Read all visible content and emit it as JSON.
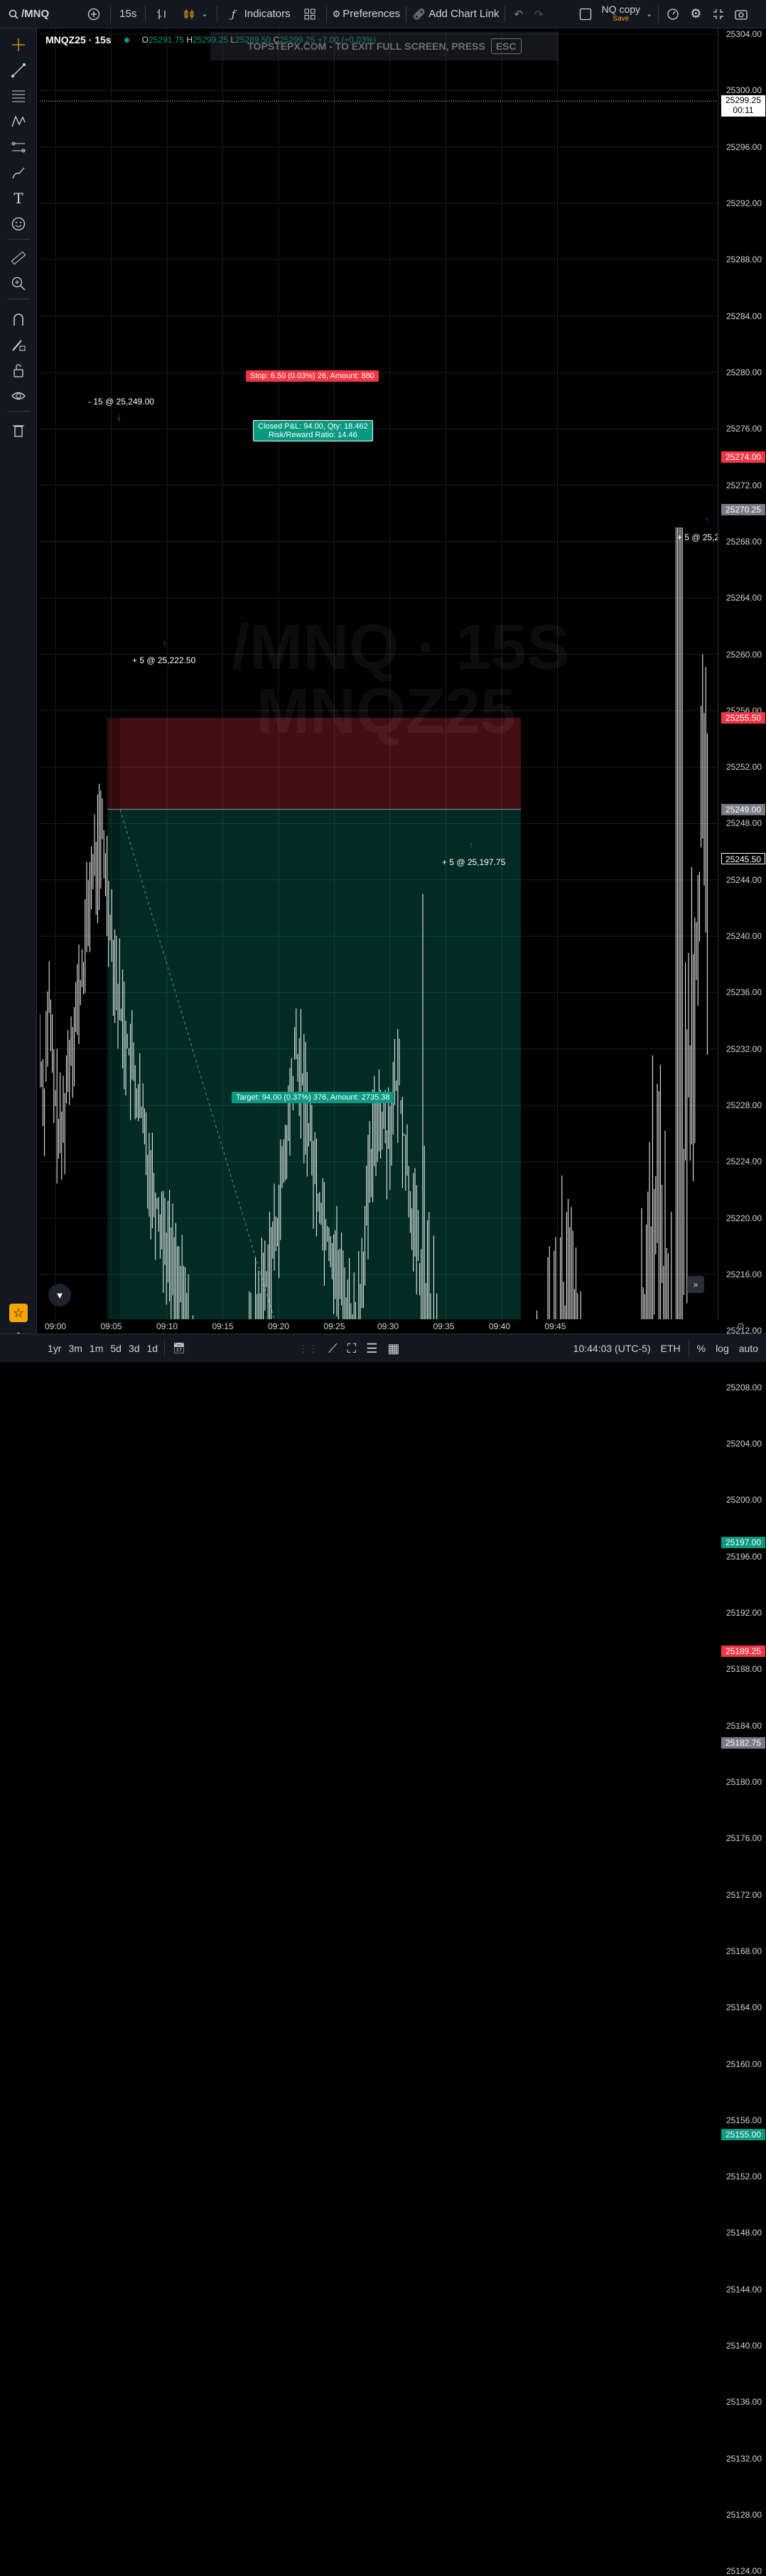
{
  "topbar": {
    "symbol": "/MNQ",
    "interval": "15s",
    "indicators": "Indicators",
    "preferences": "Preferences",
    "add_chart_link": "Add Chart Link",
    "layout_name": "NQ copy",
    "layout_save": "Save"
  },
  "legend": {
    "title": "MNQZ25 · 15s",
    "o_label": "O",
    "o": "25291.75",
    "h_label": "H",
    "h": "25299.25",
    "l_label": "L",
    "l": "25289.50",
    "c_label": "C",
    "c": "25299.25 +7.00 (+0.03%)"
  },
  "banner": {
    "text": "TOPSTEPX.COM - TO EXIT FULL SCREEN, PRESS",
    "key": "ESC"
  },
  "watermark": {
    "line1": "/MNQ · 15S",
    "line2": "MNQZ25"
  },
  "position_tool": {
    "stop_label": "Stop: 6.50 (0.03%) 26, Amount: 880",
    "pnl_line1": "Closed P&L: 94.00, Qty: 18.462",
    "pnl_line2": "Risk/Reward Ratio: 14.46",
    "target_label": "Target: 94.00 (0.37%) 376, Amount: 2735.38"
  },
  "trades": [
    {
      "label": "- 15 @ 25,249.00"
    },
    {
      "label": "+ 5 @ 25,222.50"
    },
    {
      "label": "+ 5 @ 25,197.75"
    },
    {
      "label": "+ 5 @ 25,2"
    }
  ],
  "price_axis": {
    "ticks": [
      "25304.00",
      "25300.00",
      "25296.00",
      "25292.00",
      "25288.00",
      "25284.00",
      "25280.00",
      "25276.00",
      "25272.00",
      "25268.00",
      "25264.00",
      "25260.00",
      "25256.00",
      "25252.00",
      "25248.00",
      "25244.00",
      "25240.00",
      "25236.00",
      "25232.00",
      "25228.00",
      "25224.00",
      "25220.00",
      "25216.00",
      "25212.00",
      "25208.00",
      "25204.00",
      "25200.00",
      "25196.00",
      "25192.00",
      "25188.00",
      "25184.00",
      "25180.00",
      "25176.00",
      "25172.00",
      "25168.00",
      "25164.00",
      "25160.00",
      "25156.00",
      "25152.00",
      "25148.00",
      "25144.00",
      "25140.00",
      "25136.00",
      "25132.00",
      "25128.00",
      "25124.00"
    ],
    "tags": [
      {
        "price": "25299.25",
        "sub": "00:11",
        "color": "#ffffff",
        "text": "#000000"
      },
      {
        "price": "25274.00",
        "color": "#f23645",
        "text": "#ffffff"
      },
      {
        "price": "25270.25",
        "color": "#787b86",
        "text": "#ffffff"
      },
      {
        "price": "25255.50",
        "color": "#f23645",
        "text": "#ffffff"
      },
      {
        "price": "25249.00",
        "color": "#787b86",
        "text": "#ffffff"
      },
      {
        "price": "25245.50",
        "color": "#000000",
        "text": "#ffffff"
      },
      {
        "price": "25197.00",
        "color": "#089981",
        "text": "#ffffff"
      },
      {
        "price": "25189.25",
        "color": "#f23645",
        "text": "#ffffff"
      },
      {
        "price": "25182.75",
        "color": "#787b86",
        "text": "#ffffff"
      },
      {
        "price": "25155.00",
        "color": "#089981",
        "text": "#ffffff"
      }
    ]
  },
  "time_axis": {
    "ticks": [
      "09:00",
      "09:05",
      "09:10",
      "09:15",
      "09:20",
      "09:25",
      "09:30",
      "09:35",
      "09:40",
      "09:45"
    ]
  },
  "bottombar": {
    "ranges": [
      "1yr",
      "3m",
      "1m",
      "5d",
      "3d",
      "1d"
    ],
    "clock": "10:44:03 (UTC-5)",
    "session": "ETH",
    "pct": "%",
    "log": "log",
    "auto": "auto"
  },
  "colors": {
    "up": "#ffffff",
    "stop_zone": "rgba(242,54,69,0.28)",
    "target_zone": "rgba(8,153,129,0.28)",
    "accent": "#f7a600"
  }
}
